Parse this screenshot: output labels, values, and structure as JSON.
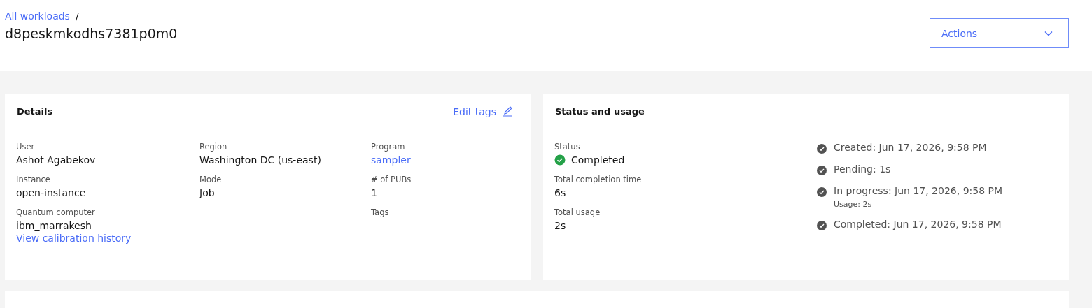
{
  "breadcrumb": {
    "link": "All workloads",
    "separator": "/"
  },
  "title": "d8peskmkodhs7381p0m0",
  "actions_button": {
    "label": "Actions"
  },
  "details": {
    "title": "Details",
    "edit_link": "Edit tags",
    "columns": [
      [
        {
          "label": "User",
          "value": "Ashot Agabekov",
          "kind": "text"
        },
        {
          "label": "Instance",
          "value": "open-instance",
          "kind": "text"
        },
        {
          "label": "Quantum computer",
          "value": "ibm_marrakesh",
          "kind": "text",
          "link": "View calibration history"
        }
      ],
      [
        {
          "label": "Region",
          "value": "Washington DC (us-east)",
          "kind": "text"
        },
        {
          "label": "Mode",
          "value": "Job",
          "kind": "text"
        }
      ],
      [
        {
          "label": "Program",
          "value": "sampler",
          "kind": "link"
        },
        {
          "label": "# of PUBs",
          "value": "1",
          "kind": "text"
        },
        {
          "label": "Tags",
          "kind": "text"
        }
      ]
    ]
  },
  "status": {
    "title": "Status and usage",
    "fields": [
      {
        "label": "Status",
        "value": "Completed",
        "kind": "status"
      },
      {
        "label": "Total completion time",
        "value": "6s",
        "kind": "text"
      },
      {
        "label": "Total usage",
        "value": "2s",
        "kind": "text"
      }
    ],
    "timeline": [
      {
        "text": "Created: Jun 17, 2026, 9:58 PM"
      },
      {
        "text": "Pending: 1s"
      },
      {
        "text": "In progress: Jun 17, 2026, 9:58 PM",
        "sub": "Usage: 2s"
      },
      {
        "text": "Completed: Jun 17, 2026, 9:58 PM"
      }
    ]
  }
}
